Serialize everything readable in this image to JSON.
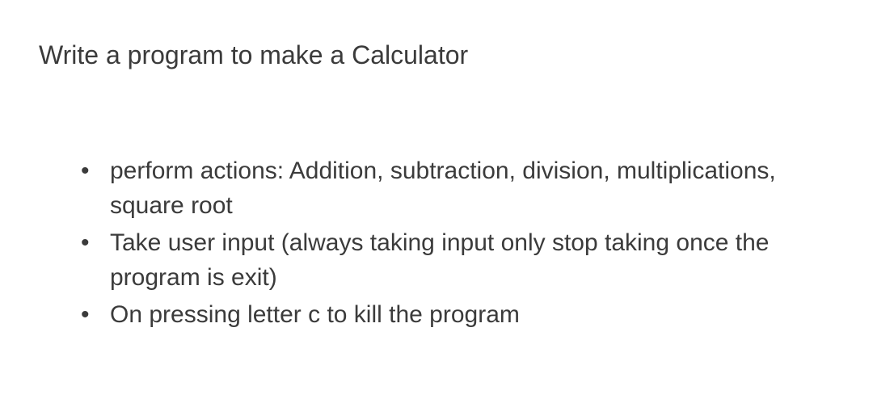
{
  "heading": "Write a program to make a Calculator",
  "bullets": {
    "item0": "perform actions: Addition, subtraction, division, multiplications, square root",
    "item1": "Take user input (always taking input only stop taking once the program is exit)",
    "item2": "On pressing letter c to kill the program"
  }
}
